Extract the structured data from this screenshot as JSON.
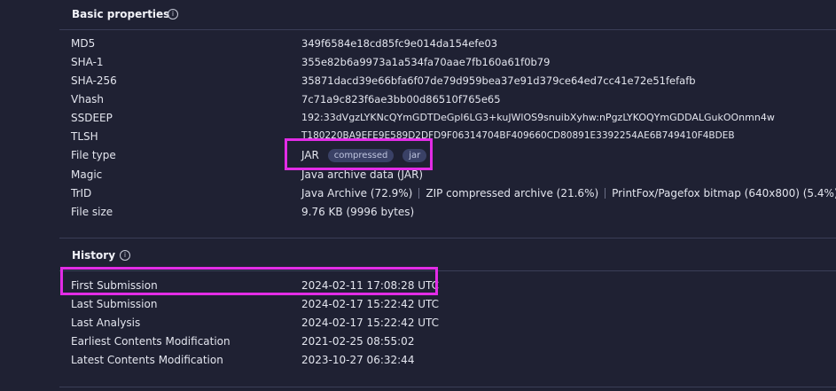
{
  "basic": {
    "title": "Basic properties",
    "info_icon": "i",
    "rows": {
      "md5": {
        "label": "MD5",
        "value": "349f6584e18cd85fc9e014da154efe03"
      },
      "sha1": {
        "label": "SHA-1",
        "value": "355e82b6a9973a1a534fa70aae7fb160a61f0b79"
      },
      "sha256": {
        "label": "SHA-256",
        "value": "35871dacd39e66bfa6f07de79d959bea37e91d379ce64ed7cc41e72e51fefafb"
      },
      "vhash": {
        "label": "Vhash",
        "value": "7c71a9c823f6ae3bb00d86510f765e65"
      },
      "ssdeep": {
        "label": "SSDEEP",
        "value": "192:33dVgzLYKNcQYmGDTDeGpl6LG3+kuJWlOS9snuibXyhw:nPgzLYKOQYmGDDALGukOOnmn4w"
      },
      "tlsh": {
        "label": "TLSH",
        "value": "T180220BA9EFE9E589D2DFD9F06314704BF409660CD80891E3392254AE6B749410F4BDEB"
      },
      "filetype": {
        "label": "File type",
        "value": "JAR",
        "tags": [
          "compressed",
          "jar"
        ]
      },
      "magic": {
        "label": "Magic",
        "value": "Java archive data (JAR)"
      },
      "trid": {
        "label": "TrID",
        "values": [
          "Java Archive (72.9%)",
          "ZIP compressed archive (21.6%)",
          "PrintFox/Pagefox bitmap (640x800) (5.4%)"
        ]
      },
      "filesize": {
        "label": "File size",
        "value": "9.76 KB (9996 bytes)"
      }
    }
  },
  "history": {
    "title": "History",
    "info_icon": "i",
    "rows": {
      "first_submission": {
        "label": "First Submission",
        "value": "2024-02-11 17:08:28 UTC"
      },
      "last_submission": {
        "label": "Last Submission",
        "value": "2024-02-17 15:22:42 UTC"
      },
      "last_analysis": {
        "label": "Last Analysis",
        "value": "2024-02-17 15:22:42 UTC"
      },
      "earliest_mod": {
        "label": "Earliest Contents Modification",
        "value": "2021-02-25 08:55:02"
      },
      "latest_mod": {
        "label": "Latest Contents Modification",
        "value": "2023-10-27 06:32:44"
      }
    }
  },
  "colors": {
    "background": "#1f2133",
    "highlight": "#e22ce6",
    "tag_bg": "#3a4166"
  }
}
